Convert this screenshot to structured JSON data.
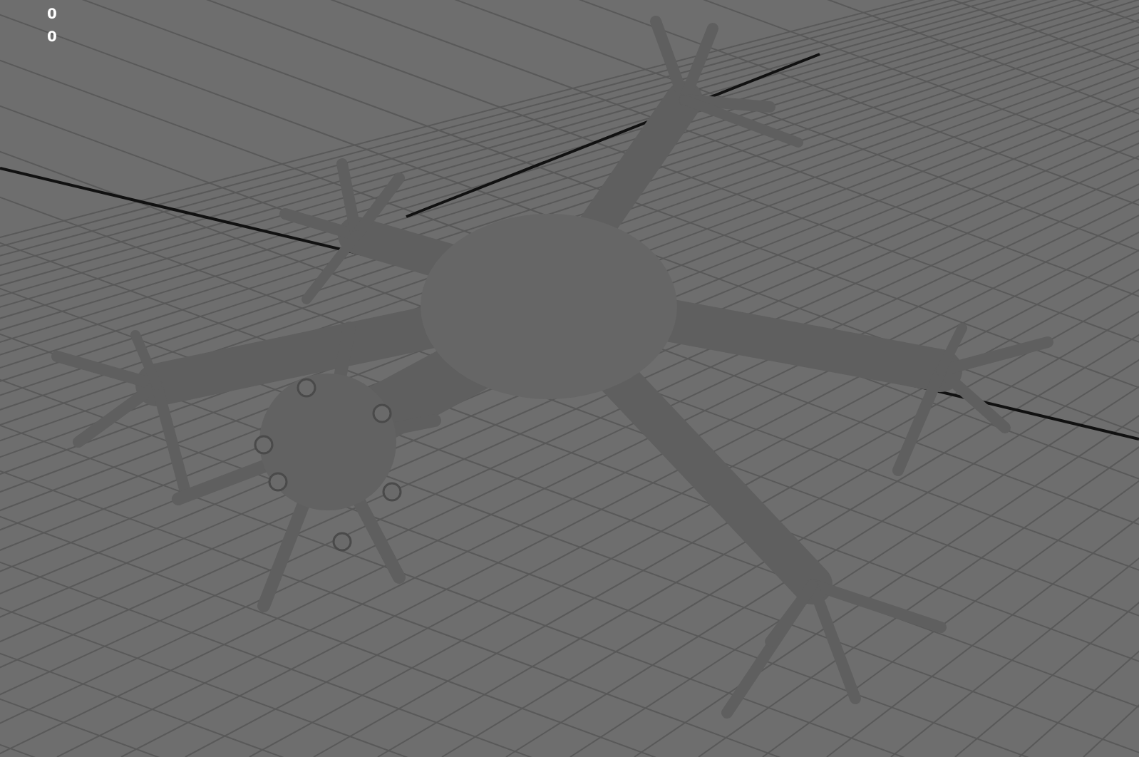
{
  "viewport": {
    "hud_readouts": [
      "0",
      "0"
    ]
  }
}
